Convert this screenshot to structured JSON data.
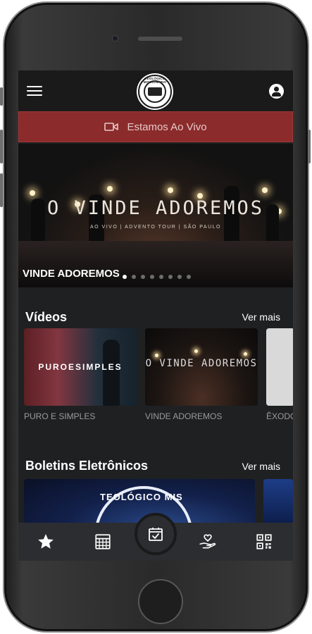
{
  "header": {
    "menu_icon": "hamburger-menu-icon",
    "logo_text": "TEOLÓGICO MISSIONÁRIO",
    "account_icon": "account-circle-icon"
  },
  "live": {
    "icon": "video-camera-icon",
    "label": "Estamos Ao Vivo",
    "color": "#8b2b2b"
  },
  "hero": {
    "title": "O VINDE ADOREMOS",
    "subtitle": "AO VIVO | ADVENTO TOUR | SÃO PAULO",
    "caption": "VINDE ADOREMOS",
    "slide_count": 8,
    "active_slide": 0
  },
  "videos": {
    "title": "Vídeos",
    "see_more": "Ver mais",
    "items": [
      {
        "thumb_text": "PUROESIMPLES",
        "label": "PURO E SIMPLES"
      },
      {
        "thumb_text": "O VINDE ADOREMOS",
        "label": "VINDE ADOREMOS"
      },
      {
        "thumb_text": "",
        "label": "ÊXODO"
      }
    ]
  },
  "bulletins": {
    "title": "Boletins Eletrônicos",
    "see_more": "Ver mais",
    "items": [
      {
        "thumb_text": "TEOLÓGICO MIS"
      }
    ]
  },
  "bottom_nav": {
    "items": [
      "star-icon",
      "calendar-grid-icon",
      "calendar-check-icon",
      "hand-heart-icon",
      "qr-code-icon"
    ],
    "active": "calendar-check-icon"
  }
}
